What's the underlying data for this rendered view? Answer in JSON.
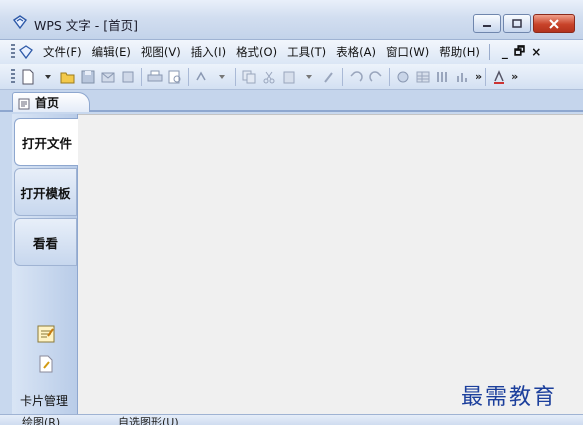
{
  "window": {
    "title": "WPS 文字 - [首页]"
  },
  "menu": {
    "items": [
      "文件(F)",
      "编辑(E)",
      "视图(V)",
      "插入(I)",
      "格式(O)",
      "工具(T)",
      "表格(A)",
      "窗口(W)",
      "帮助(H)"
    ],
    "mdi_minimize": "_",
    "mdi_restore": "🗗",
    "mdi_close": "×"
  },
  "toolbar": {
    "overflow_label": "»",
    "overflow2_label": "»"
  },
  "tabs": {
    "home_label": "首页"
  },
  "sidebar": {
    "items": [
      "打开文件",
      "打开模板",
      "看看"
    ],
    "card_manager_label": "卡片管理"
  },
  "bottom_toolbar": {
    "draw_label": "绘图(R)",
    "autoshape_label": "自选图形(U)"
  },
  "watermark": {
    "text": "最需教育"
  },
  "colors": {
    "accent": "#8ea7cf",
    "close_button": "#c8432a",
    "watermark": "#1c3f9c"
  }
}
